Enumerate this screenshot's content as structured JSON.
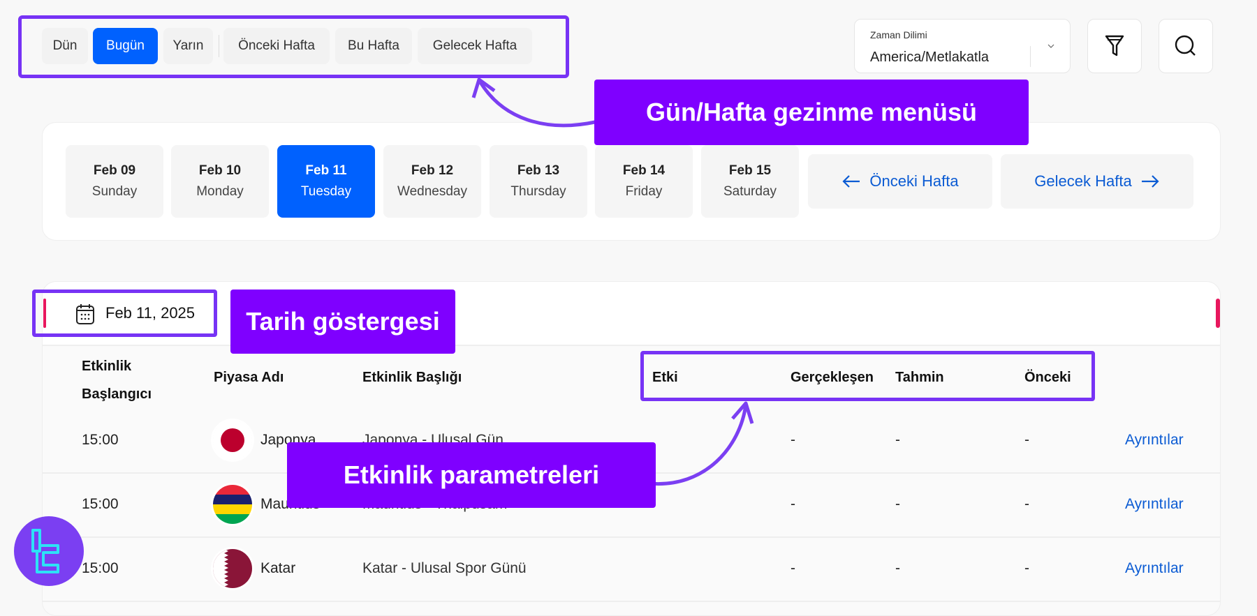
{
  "nav": {
    "items": [
      {
        "label": "Dün",
        "active": false
      },
      {
        "label": "Bugün",
        "active": true
      },
      {
        "label": "Yarın",
        "active": false
      },
      {
        "label": "Önceki Hafta",
        "active": false
      },
      {
        "label": "Bu Hafta",
        "active": false
      },
      {
        "label": "Gelecek Hafta",
        "active": false
      }
    ]
  },
  "timezone": {
    "label": "Zaman Dilimi",
    "value": "America/Metlakatla"
  },
  "icons": {
    "filter": "filter-icon",
    "search": "search-icon",
    "calendar": "calendar-icon"
  },
  "days": [
    {
      "date": "Feb 09",
      "weekday": "Sunday",
      "active": false
    },
    {
      "date": "Feb 10",
      "weekday": "Monday",
      "active": false
    },
    {
      "date": "Feb 11",
      "weekday": "Tuesday",
      "active": true
    },
    {
      "date": "Feb 12",
      "weekday": "Wednesday",
      "active": false
    },
    {
      "date": "Feb 13",
      "weekday": "Thursday",
      "active": false
    },
    {
      "date": "Feb 14",
      "weekday": "Friday",
      "active": false
    },
    {
      "date": "Feb 15",
      "weekday": "Saturday",
      "active": false
    }
  ],
  "week_nav": {
    "prev": "Önceki Hafta",
    "next": "Gelecek Hafta"
  },
  "date_indicator": "Feb 11, 2025",
  "table": {
    "headers": {
      "start_1": "Etkinlik",
      "start_2": "Başlangıcı",
      "market": "Piyasa Adı",
      "title": "Etkinlik Başlığı",
      "impact": "Etki",
      "actual": "Gerçekleşen",
      "forecast": "Tahmin",
      "previous": "Önceki"
    },
    "rows": [
      {
        "time": "15:00",
        "market": "Japonya",
        "title": "Japonya - Ulusal Gün",
        "impact": "",
        "actual": "-",
        "forecast": "-",
        "previous": "-",
        "details": "Ayrıntılar"
      },
      {
        "time": "15:00",
        "market": "Mauritius",
        "title": "Mauritius - Thaipusam",
        "impact": "",
        "actual": "-",
        "forecast": "-",
        "previous": "-",
        "details": "Ayrıntılar"
      },
      {
        "time": "15:00",
        "market": "Katar",
        "title": "Katar - Ulusal Spor Günü",
        "impact": "",
        "actual": "-",
        "forecast": "-",
        "previous": "-",
        "details": "Ayrıntılar"
      }
    ]
  },
  "annotations": {
    "nav_menu": "Gün/Hafta gezinme menüsü",
    "date_indicator": "Tarih göstergesi",
    "event_params": "Etkinlik parametreleri"
  },
  "colors": {
    "accent": "#0061fe",
    "annotation": "#7f00ff",
    "indicator": "#e8175d"
  }
}
